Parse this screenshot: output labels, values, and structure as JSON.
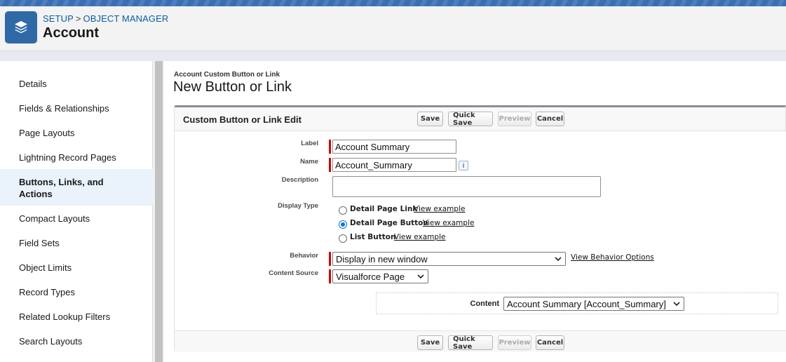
{
  "header": {
    "breadcrumb": [
      "SETUP",
      "OBJECT MANAGER"
    ],
    "breadcrumb_sep": ">",
    "title": "Account",
    "app_icon": "layers-icon"
  },
  "sidebar": {
    "items": [
      {
        "label": "Details"
      },
      {
        "label": "Fields & Relationships"
      },
      {
        "label": "Page Layouts"
      },
      {
        "label": "Lightning Record Pages"
      },
      {
        "label": "Buttons, Links, and Actions",
        "active": true
      },
      {
        "label": "Compact Layouts"
      },
      {
        "label": "Field Sets"
      },
      {
        "label": "Object Limits"
      },
      {
        "label": "Record Types"
      },
      {
        "label": "Related Lookup Filters"
      },
      {
        "label": "Search Layouts"
      }
    ]
  },
  "page": {
    "subtitle": "Account Custom Button or Link",
    "title": "New Button or Link"
  },
  "panel": {
    "title": "Custom Button or Link Edit",
    "buttons": {
      "save": "Save",
      "quick_save": "Quick Save",
      "preview": "Preview",
      "cancel": "Cancel"
    }
  },
  "form": {
    "label": {
      "label": "Label",
      "value": "Account Summary"
    },
    "name": {
      "label": "Name",
      "value": "Account_Summary",
      "info": "i"
    },
    "description": {
      "label": "Description",
      "value": ""
    },
    "display_type": {
      "label": "Display Type",
      "options": [
        {
          "label": "Detail Page Link",
          "link": "View example",
          "checked": false
        },
        {
          "label": "Detail Page Button",
          "link": "View example",
          "checked": true
        },
        {
          "label": "List Button",
          "link": "View example",
          "checked": false
        }
      ]
    },
    "behavior": {
      "label": "Behavior",
      "value": "Display in new window",
      "link": "View Behavior Options"
    },
    "content_source": {
      "label": "Content Source",
      "value": "Visualforce Page"
    },
    "content": {
      "label": "Content",
      "value": "Account Summary [Account_Summary]"
    }
  },
  "colors": {
    "brand": "#2f6aa7",
    "required": "#cc0000",
    "link": "#0b5cab",
    "radio_checked": "#0a74da"
  }
}
